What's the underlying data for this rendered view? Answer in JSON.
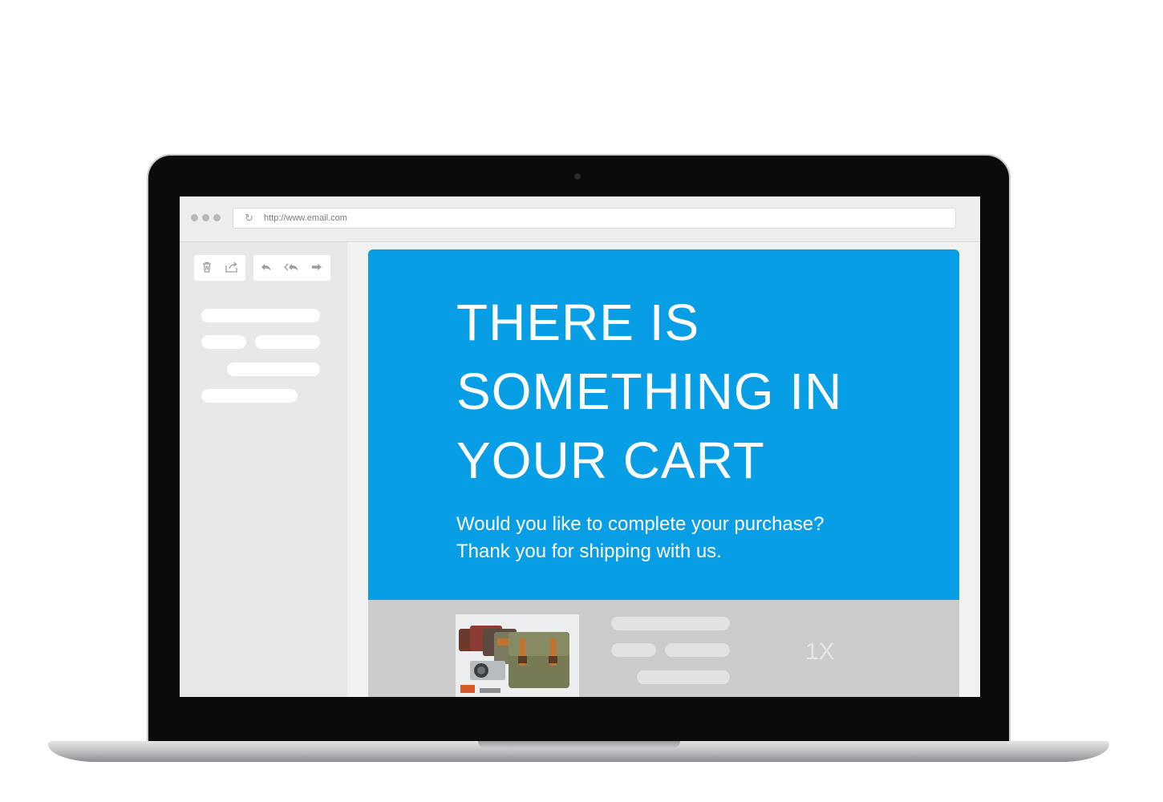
{
  "browser": {
    "url": "http://www.email.com",
    "icons": {
      "refresh": "refresh-icon"
    }
  },
  "toolbar": {
    "icons": [
      "trash-icon",
      "share-icon",
      "reply-icon",
      "reply-all-icon",
      "forward-icon"
    ]
  },
  "email": {
    "headline_lines": [
      "THERE IS",
      "SOMETHING IN",
      "YOUR CART"
    ],
    "subtext_lines": [
      "Would you like to complete your purchase?",
      "Thank you for shipping with us."
    ],
    "cart": {
      "quantity": "1X",
      "product_image": "messenger-bags-photo"
    }
  },
  "colors": {
    "accent": "#079ee6",
    "cart_background": "#cbcbcb",
    "sidebar": "#e8e8e8"
  }
}
